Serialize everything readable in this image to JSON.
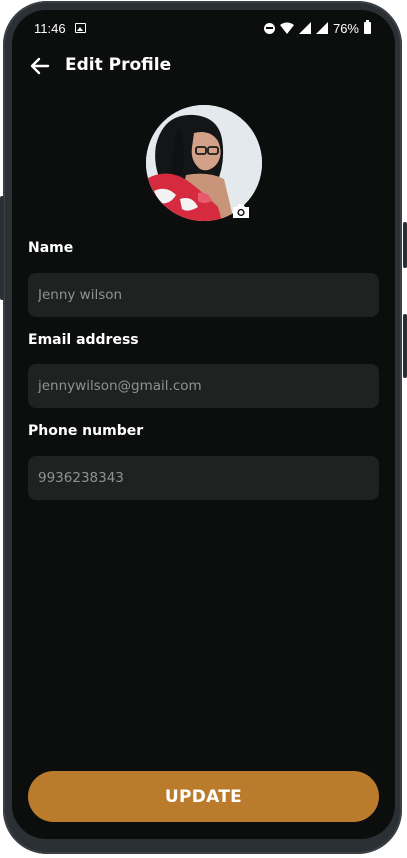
{
  "status_bar": {
    "time": "11:46",
    "battery_percent": "76%",
    "icons": [
      "image-icon",
      "dnd-icon",
      "wifi-icon",
      "signal-icon",
      "signal-icon",
      "battery-icon"
    ]
  },
  "header": {
    "title": "Edit Profile",
    "back_icon": "arrow-left-icon"
  },
  "profile": {
    "camera_icon": "camera-icon"
  },
  "form": {
    "name": {
      "label": "Name",
      "value": "Jenny wilson"
    },
    "email": {
      "label": "Email address",
      "value": "jennywilson@gmail.com"
    },
    "phone": {
      "label": "Phone number",
      "value": "9936238343"
    }
  },
  "actions": {
    "update_label": "UPDATE"
  },
  "colors": {
    "background": "#0b0e0c",
    "input_background": "#1f2221",
    "accent": "#bb7b2c",
    "input_text": "#8f9290",
    "frame": "#2b3034"
  }
}
